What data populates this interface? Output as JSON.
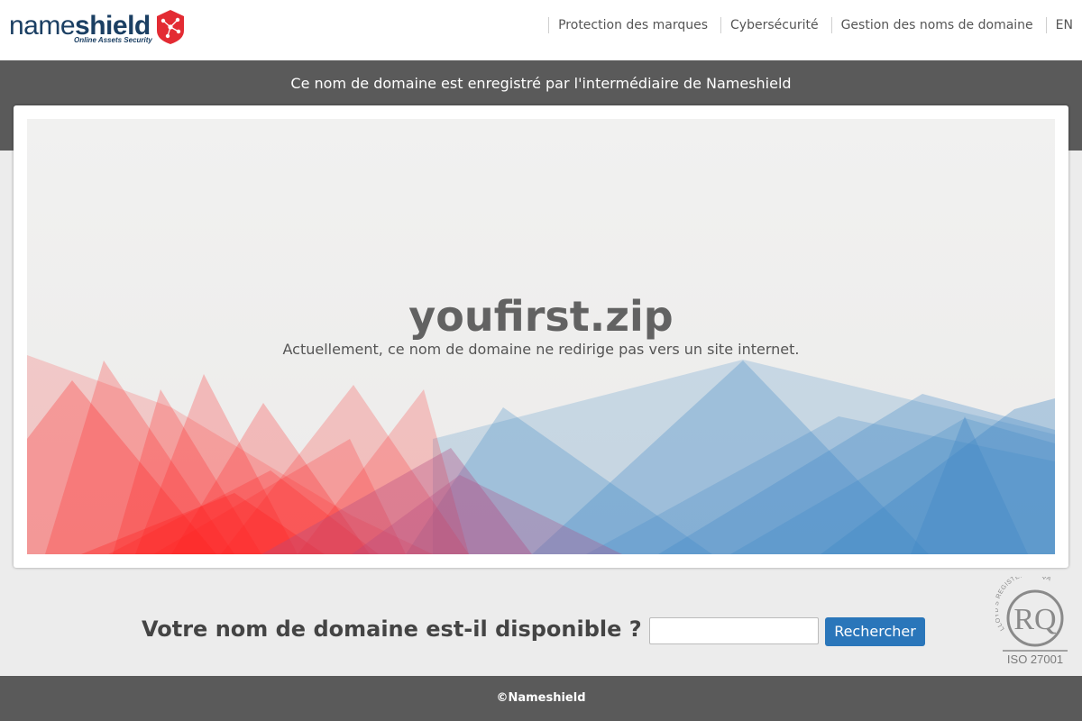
{
  "logo": {
    "name_light": "name",
    "name_bold": "shield",
    "tagline": "Online Assets Security",
    "brand_color": "#1b3f63",
    "shield_color": "#e32b33"
  },
  "nav": {
    "items": [
      {
        "label": "Protection des marques"
      },
      {
        "label": "Cybersécurité"
      },
      {
        "label": "Gestion des noms de domaine"
      },
      {
        "label": "EN"
      }
    ]
  },
  "banner": {
    "text": "Ce nom de domaine est enregistré par l'intermédiaire de Nameshield"
  },
  "hero": {
    "domain": "youfirst.zip",
    "subtitle": "Actuellement, ce nom de domaine ne redirige pas vers un site internet.",
    "colors": {
      "red": "#ff1f1f",
      "blue": "#3e88c6"
    }
  },
  "search": {
    "label": "Votre nom de domaine est-il disponible ?",
    "input_value": "",
    "input_placeholder": "",
    "button_label": "Rechercher",
    "button_color": "#2a76ba"
  },
  "certification": {
    "label": "ISO 27001",
    "ring_text": "LLOYD'S REGISTER · LRQA",
    "mark": "RQ"
  },
  "footer": {
    "text": "©Nameshield"
  }
}
